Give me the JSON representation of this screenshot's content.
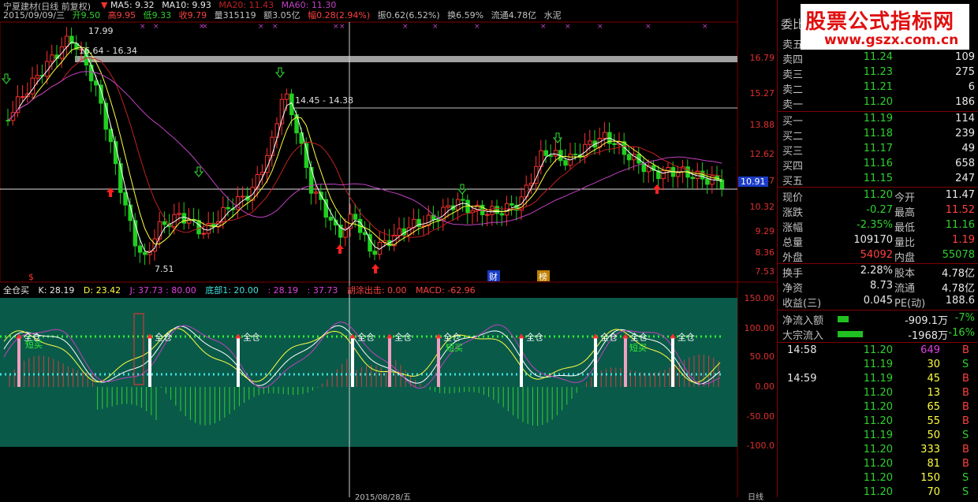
{
  "header": {
    "stock_name": "宁夏建材(日线 前复权)",
    "date": "2015/09/09/三",
    "open": "开9.50",
    "high": "高9.95",
    "low": "低9.33",
    "close": "收9.79",
    "volume": "量315119",
    "amount": "额3.05亿",
    "change_pct": "幅0.28(2.94%)",
    "amplitude": "振0.62(6.52%)",
    "turnover": "换6.59%",
    "float_cap": "流通4.78亿",
    "industry": "水泥"
  },
  "ma": {
    "ma5": "MA5: 9.32",
    "ma10": "MA10: 9.93",
    "ma20": "MA20: 11.43",
    "ma60": "MA60: 11.30"
  },
  "annotations": {
    "high_label": "17.99",
    "low_label": "7.51",
    "range1": "16.64 - 16.34",
    "range2": "14.45 - 14.38",
    "cai": "财",
    "bang": "榜",
    "s_mark": "$"
  },
  "price_axis": [
    "16.79",
    "15.27",
    "13.88",
    "12.62",
    "11.47",
    "10.32",
    "9.29",
    "8.36",
    "7.53"
  ],
  "current_price_tag": "10.91",
  "indicator": {
    "name": "全仓买",
    "k": "K: 28.19",
    "d": "D: 23.42",
    "j": "J: 37.73 : 80.00",
    "bottom": "底部1: 20.00",
    "v1": ": 28.19",
    "v2": ": 37.73",
    "v3": "胡涂出击: 0.00",
    "macd": "MACD: -62.96",
    "quancang": "全仓",
    "duanmai": "短买"
  },
  "indicator_axis": [
    "150.00",
    "100.00",
    "50.00",
    "0.00",
    "-50.00",
    "-100.0"
  ],
  "bottom_axis": {
    "date_label": "2015/08/28/五",
    "right_label": "日线"
  },
  "side": {
    "title": "委比",
    "sell": [
      {
        "label": "卖五",
        "price": "",
        "vol": ""
      },
      {
        "label": "卖四",
        "price": "11.24",
        "vol": "109"
      },
      {
        "label": "卖三",
        "price": "11.23",
        "vol": "275"
      },
      {
        "label": "卖二",
        "price": "11.21",
        "vol": "6"
      },
      {
        "label": "卖一",
        "price": "11.20",
        "vol": "186"
      }
    ],
    "buy": [
      {
        "label": "买一",
        "price": "11.19",
        "vol": "114"
      },
      {
        "label": "买二",
        "price": "11.18",
        "vol": "239"
      },
      {
        "label": "买三",
        "price": "11.17",
        "vol": "49"
      },
      {
        "label": "买四",
        "price": "11.16",
        "vol": "658"
      },
      {
        "label": "买五",
        "price": "11.15",
        "vol": "247"
      }
    ],
    "stats": [
      {
        "l1": "现价",
        "v1": "11.20",
        "c1": "green",
        "l2": "今开",
        "v2": "11.47",
        "c2": "white"
      },
      {
        "l1": "涨跌",
        "v1": "-0.27",
        "c1": "green",
        "l2": "最高",
        "v2": "11.52",
        "c2": "red"
      },
      {
        "l1": "涨幅",
        "v1": "-2.35%",
        "c1": "green",
        "l2": "最低",
        "v2": "11.16",
        "c2": "green"
      },
      {
        "l1": "总量",
        "v1": "109170",
        "c1": "white",
        "l2": "量比",
        "v2": "1.19",
        "c2": "red"
      },
      {
        "l1": "外盘",
        "v1": "54092",
        "c1": "red",
        "l2": "内盘",
        "v2": "55078",
        "c2": "green"
      }
    ],
    "fin": [
      {
        "l1": "换手",
        "v1": "2.28%",
        "l2": "股本",
        "v2": "4.78亿"
      },
      {
        "l1": "净资",
        "v1": "8.73",
        "l2": "流通",
        "v2": "4.78亿"
      },
      {
        "l1": "收益(三)",
        "v1": "0.045",
        "l2": "PE(动)",
        "v2": "188.6"
      }
    ],
    "flow": [
      {
        "label": "净流入额",
        "val": "-909.1万",
        "pct": "-7%",
        "fill": 0.07
      },
      {
        "label": "大宗流入",
        "val": "-1968万",
        "pct": "-16%",
        "fill": 0.16
      }
    ],
    "ticks": [
      {
        "t": "14:58",
        "p": "11.20",
        "q": "649",
        "s": "B",
        "qc": "purple"
      },
      {
        "t": "",
        "p": "11.19",
        "q": "30",
        "s": "S",
        "qc": "yellow"
      },
      {
        "t": "14:59",
        "p": "11.19",
        "q": "45",
        "s": "B",
        "qc": "yellow"
      },
      {
        "t": "",
        "p": "11.20",
        "q": "13",
        "s": "B",
        "qc": "yellow"
      },
      {
        "t": "",
        "p": "11.20",
        "q": "65",
        "s": "B",
        "qc": "yellow"
      },
      {
        "t": "",
        "p": "11.20",
        "q": "55",
        "s": "B",
        "qc": "yellow"
      },
      {
        "t": "",
        "p": "11.19",
        "q": "50",
        "s": "S",
        "qc": "yellow"
      },
      {
        "t": "",
        "p": "11.20",
        "q": "333",
        "s": "B",
        "qc": "yellow"
      },
      {
        "t": "",
        "p": "11.20",
        "q": "81",
        "s": "B",
        "qc": "yellow"
      },
      {
        "t": "",
        "p": "11.20",
        "q": "150",
        "s": "S",
        "qc": "yellow"
      },
      {
        "t": "",
        "p": "11.20",
        "q": "70",
        "s": "S",
        "qc": "yellow"
      }
    ]
  },
  "logo": {
    "line1": "股票公式指标网",
    "line2": "www.gszx.com.cn"
  },
  "colors": {
    "up": "#ff3030",
    "down": "#20d020",
    "ma5": "#ffffff",
    "ma10": "#ffff40",
    "ma20": "#c02020",
    "ma60": "#c040c0",
    "panel_bg": "#0a5a4a"
  }
}
